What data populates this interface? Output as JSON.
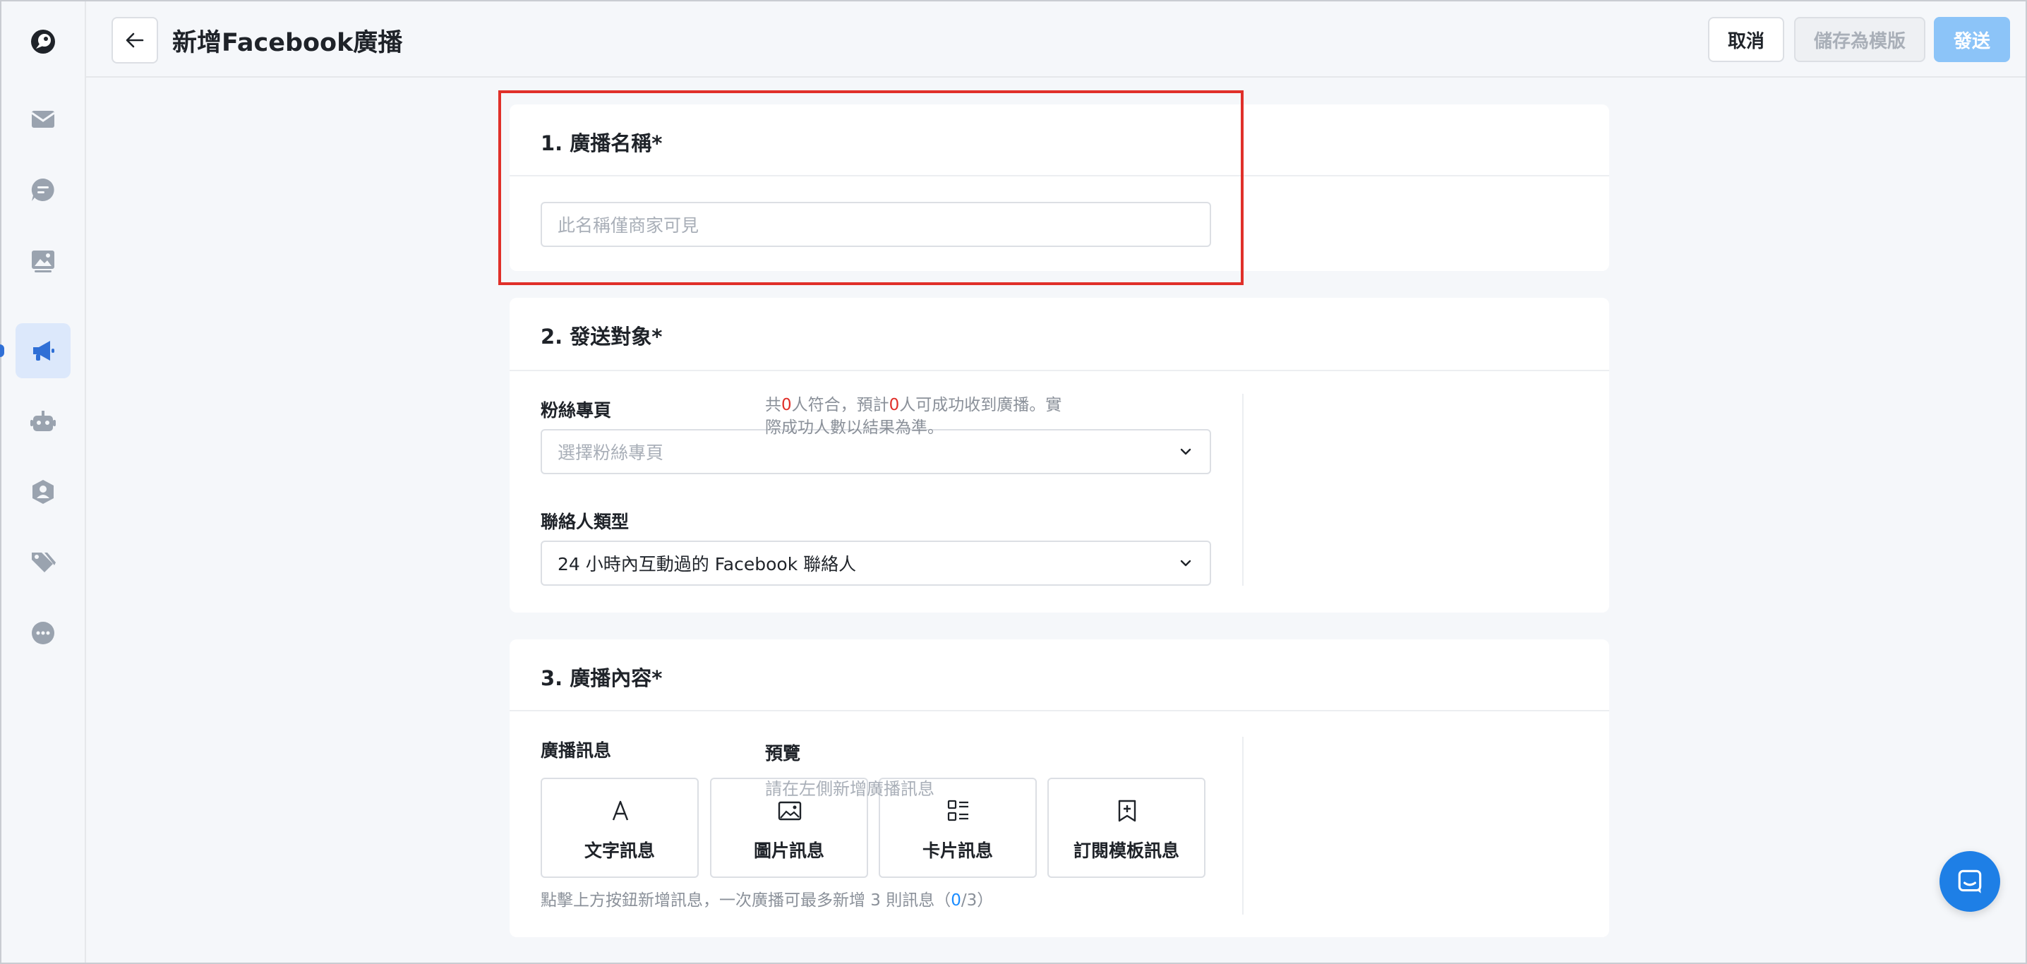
{
  "header": {
    "title": "新增Facebook廣播",
    "cancel_label": "取消",
    "save_template_label": "儲存為模版",
    "send_label": "發送"
  },
  "section_name": {
    "title": "1. 廣播名稱*",
    "input_placeholder": "此名稱僅商家可見",
    "input_value": ""
  },
  "section_target": {
    "title": "2. 發送對象*",
    "page_label": "粉絲專頁",
    "page_placeholder": "選擇粉絲專頁",
    "contact_type_label": "聯絡人類型",
    "contact_type_value": "24 小時內互動過的 Facebook 聯絡人",
    "summary": {
      "prefix": "共",
      "matched_count": "0",
      "middle": "人符合，預計",
      "reachable_count": "0",
      "suffix": "人可成功收到廣播。實際成功人數以結果為準。"
    }
  },
  "section_content": {
    "title": "3. 廣播內容*",
    "message_label": "廣播訊息",
    "buttons": [
      {
        "label": "文字訊息",
        "icon": "text-icon"
      },
      {
        "label": "圖片訊息",
        "icon": "image-icon"
      },
      {
        "label": "卡片訊息",
        "icon": "card-icon"
      },
      {
        "label": "訂閱模板訊息",
        "icon": "subscription-template-icon"
      }
    ],
    "hint_prefix": "點擊上方按鈕新增訊息，一次廣播可最多新增 3 則訊息（",
    "hint_current": "0",
    "hint_suffix": "/3）",
    "preview_title": "預覽",
    "preview_hint": "請在左側新增廣播訊息"
  },
  "sidebar": {
    "items": [
      {
        "icon": "logo-icon"
      },
      {
        "icon": "inbox-icon"
      },
      {
        "icon": "chat-icon"
      },
      {
        "icon": "media-icon"
      },
      {
        "icon": "broadcast-icon",
        "active": true
      },
      {
        "icon": "bot-icon"
      },
      {
        "icon": "contacts-icon"
      },
      {
        "icon": "tags-icon"
      },
      {
        "icon": "more-icon"
      }
    ]
  },
  "colors": {
    "accent": "#2f6fd6",
    "send_disabled": "#8cc4f8",
    "highlight_red": "#e0302a",
    "count_blue": "#1a8cff"
  }
}
